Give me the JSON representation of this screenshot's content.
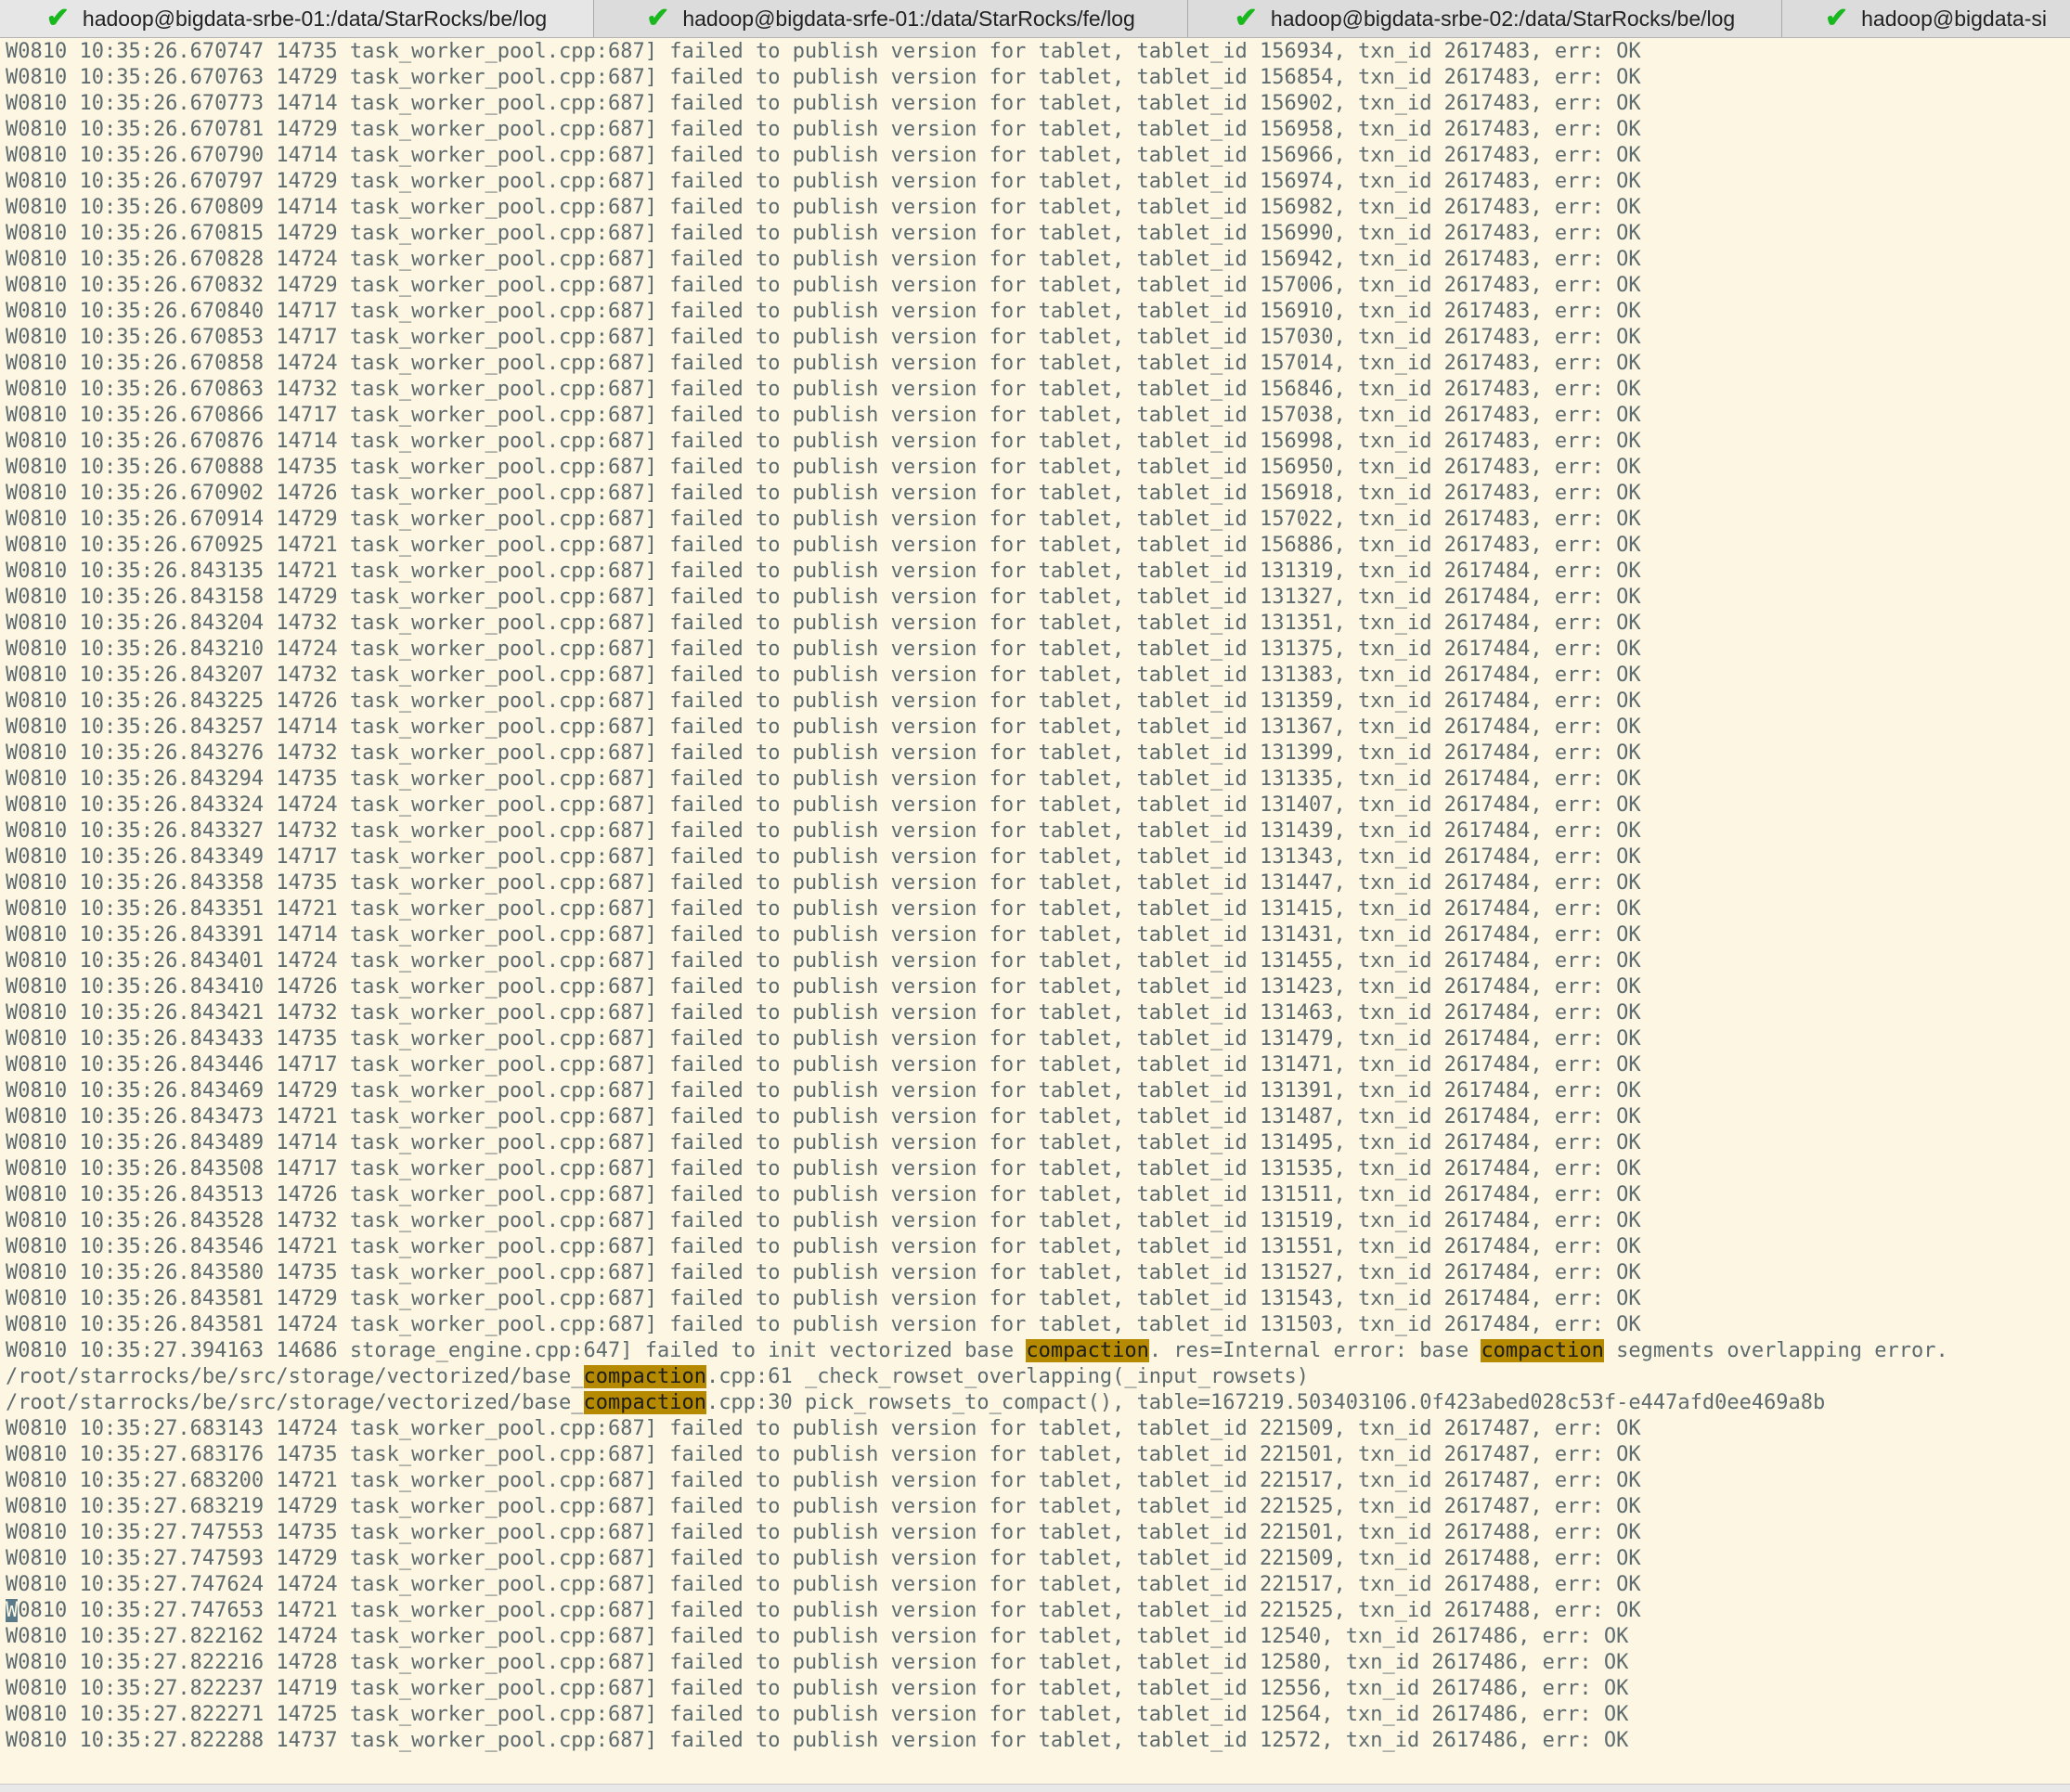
{
  "tabs": [
    {
      "title": "hadoop@bigdata-srbe-01:/data/StarRocks/be/log",
      "active": true
    },
    {
      "title": "hadoop@bigdata-srfe-01:/data/StarRocks/fe/log",
      "active": false
    },
    {
      "title": "hadoop@bigdata-srbe-02:/data/StarRocks/be/log",
      "active": false
    },
    {
      "title": "hadoop@bigdata-si",
      "active": false
    }
  ],
  "colors": {
    "background": "#fdf6e3",
    "text": "#5d6b6e",
    "highlight": "#b58a00",
    "tab_check": "#18b81e"
  },
  "highlight_term": "compaction",
  "terminal_lines": [
    "W0810 10:35:26.670747 14735 task_worker_pool.cpp:687] failed to publish version for tablet, tablet_id 156934, txn_id 2617483, err: OK",
    "W0810 10:35:26.670763 14729 task_worker_pool.cpp:687] failed to publish version for tablet, tablet_id 156854, txn_id 2617483, err: OK",
    "W0810 10:35:26.670773 14714 task_worker_pool.cpp:687] failed to publish version for tablet, tablet_id 156902, txn_id 2617483, err: OK",
    "W0810 10:35:26.670781 14729 task_worker_pool.cpp:687] failed to publish version for tablet, tablet_id 156958, txn_id 2617483, err: OK",
    "W0810 10:35:26.670790 14714 task_worker_pool.cpp:687] failed to publish version for tablet, tablet_id 156966, txn_id 2617483, err: OK",
    "W0810 10:35:26.670797 14729 task_worker_pool.cpp:687] failed to publish version for tablet, tablet_id 156974, txn_id 2617483, err: OK",
    "W0810 10:35:26.670809 14714 task_worker_pool.cpp:687] failed to publish version for tablet, tablet_id 156982, txn_id 2617483, err: OK",
    "W0810 10:35:26.670815 14729 task_worker_pool.cpp:687] failed to publish version for tablet, tablet_id 156990, txn_id 2617483, err: OK",
    "W0810 10:35:26.670828 14724 task_worker_pool.cpp:687] failed to publish version for tablet, tablet_id 156942, txn_id 2617483, err: OK",
    "W0810 10:35:26.670832 14729 task_worker_pool.cpp:687] failed to publish version for tablet, tablet_id 157006, txn_id 2617483, err: OK",
    "W0810 10:35:26.670840 14717 task_worker_pool.cpp:687] failed to publish version for tablet, tablet_id 156910, txn_id 2617483, err: OK",
    "W0810 10:35:26.670853 14717 task_worker_pool.cpp:687] failed to publish version for tablet, tablet_id 157030, txn_id 2617483, err: OK",
    "W0810 10:35:26.670858 14724 task_worker_pool.cpp:687] failed to publish version for tablet, tablet_id 157014, txn_id 2617483, err: OK",
    "W0810 10:35:26.670863 14732 task_worker_pool.cpp:687] failed to publish version for tablet, tablet_id 156846, txn_id 2617483, err: OK",
    "W0810 10:35:26.670866 14717 task_worker_pool.cpp:687] failed to publish version for tablet, tablet_id 157038, txn_id 2617483, err: OK",
    "W0810 10:35:26.670876 14714 task_worker_pool.cpp:687] failed to publish version for tablet, tablet_id 156998, txn_id 2617483, err: OK",
    "W0810 10:35:26.670888 14735 task_worker_pool.cpp:687] failed to publish version for tablet, tablet_id 156950, txn_id 2617483, err: OK",
    "W0810 10:35:26.670902 14726 task_worker_pool.cpp:687] failed to publish version for tablet, tablet_id 156918, txn_id 2617483, err: OK",
    "W0810 10:35:26.670914 14729 task_worker_pool.cpp:687] failed to publish version for tablet, tablet_id 157022, txn_id 2617483, err: OK",
    "W0810 10:35:26.670925 14721 task_worker_pool.cpp:687] failed to publish version for tablet, tablet_id 156886, txn_id 2617483, err: OK",
    "W0810 10:35:26.843135 14721 task_worker_pool.cpp:687] failed to publish version for tablet, tablet_id 131319, txn_id 2617484, err: OK",
    "W0810 10:35:26.843158 14729 task_worker_pool.cpp:687] failed to publish version for tablet, tablet_id 131327, txn_id 2617484, err: OK",
    "W0810 10:35:26.843204 14732 task_worker_pool.cpp:687] failed to publish version for tablet, tablet_id 131351, txn_id 2617484, err: OK",
    "W0810 10:35:26.843210 14724 task_worker_pool.cpp:687] failed to publish version for tablet, tablet_id 131375, txn_id 2617484, err: OK",
    "W0810 10:35:26.843207 14732 task_worker_pool.cpp:687] failed to publish version for tablet, tablet_id 131383, txn_id 2617484, err: OK",
    "W0810 10:35:26.843225 14726 task_worker_pool.cpp:687] failed to publish version for tablet, tablet_id 131359, txn_id 2617484, err: OK",
    "W0810 10:35:26.843257 14714 task_worker_pool.cpp:687] failed to publish version for tablet, tablet_id 131367, txn_id 2617484, err: OK",
    "W0810 10:35:26.843276 14732 task_worker_pool.cpp:687] failed to publish version for tablet, tablet_id 131399, txn_id 2617484, err: OK",
    "W0810 10:35:26.843294 14735 task_worker_pool.cpp:687] failed to publish version for tablet, tablet_id 131335, txn_id 2617484, err: OK",
    "W0810 10:35:26.843324 14724 task_worker_pool.cpp:687] failed to publish version for tablet, tablet_id 131407, txn_id 2617484, err: OK",
    "W0810 10:35:26.843327 14732 task_worker_pool.cpp:687] failed to publish version for tablet, tablet_id 131439, txn_id 2617484, err: OK",
    "W0810 10:35:26.843349 14717 task_worker_pool.cpp:687] failed to publish version for tablet, tablet_id 131343, txn_id 2617484, err: OK",
    "W0810 10:35:26.843358 14735 task_worker_pool.cpp:687] failed to publish version for tablet, tablet_id 131447, txn_id 2617484, err: OK",
    "W0810 10:35:26.843351 14721 task_worker_pool.cpp:687] failed to publish version for tablet, tablet_id 131415, txn_id 2617484, err: OK",
    "W0810 10:35:26.843391 14714 task_worker_pool.cpp:687] failed to publish version for tablet, tablet_id 131431, txn_id 2617484, err: OK",
    "W0810 10:35:26.843401 14724 task_worker_pool.cpp:687] failed to publish version for tablet, tablet_id 131455, txn_id 2617484, err: OK",
    "W0810 10:35:26.843410 14726 task_worker_pool.cpp:687] failed to publish version for tablet, tablet_id 131423, txn_id 2617484, err: OK",
    "W0810 10:35:26.843421 14732 task_worker_pool.cpp:687] failed to publish version for tablet, tablet_id 131463, txn_id 2617484, err: OK",
    "W0810 10:35:26.843433 14735 task_worker_pool.cpp:687] failed to publish version for tablet, tablet_id 131479, txn_id 2617484, err: OK",
    "W0810 10:35:26.843446 14717 task_worker_pool.cpp:687] failed to publish version for tablet, tablet_id 131471, txn_id 2617484, err: OK",
    "W0810 10:35:26.843469 14729 task_worker_pool.cpp:687] failed to publish version for tablet, tablet_id 131391, txn_id 2617484, err: OK",
    "W0810 10:35:26.843473 14721 task_worker_pool.cpp:687] failed to publish version for tablet, tablet_id 131487, txn_id 2617484, err: OK",
    "W0810 10:35:26.843489 14714 task_worker_pool.cpp:687] failed to publish version for tablet, tablet_id 131495, txn_id 2617484, err: OK",
    "W0810 10:35:26.843508 14717 task_worker_pool.cpp:687] failed to publish version for tablet, tablet_id 131535, txn_id 2617484, err: OK",
    "W0810 10:35:26.843513 14726 task_worker_pool.cpp:687] failed to publish version for tablet, tablet_id 131511, txn_id 2617484, err: OK",
    "W0810 10:35:26.843528 14732 task_worker_pool.cpp:687] failed to publish version for tablet, tablet_id 131519, txn_id 2617484, err: OK",
    "W0810 10:35:26.843546 14721 task_worker_pool.cpp:687] failed to publish version for tablet, tablet_id 131551, txn_id 2617484, err: OK",
    "W0810 10:35:26.843580 14735 task_worker_pool.cpp:687] failed to publish version for tablet, tablet_id 131527, txn_id 2617484, err: OK",
    "W0810 10:35:26.843581 14729 task_worker_pool.cpp:687] failed to publish version for tablet, tablet_id 131543, txn_id 2617484, err: OK",
    "W0810 10:35:26.843581 14724 task_worker_pool.cpp:687] failed to publish version for tablet, tablet_id 131503, txn_id 2617484, err: OK",
    "W0810 10:35:27.394163 14686 storage_engine.cpp:647] failed to init vectorized base compaction. res=Internal error: base compaction segments overlapping error.",
    "/root/starrocks/be/src/storage/vectorized/base_compaction.cpp:61 _check_rowset_overlapping(_input_rowsets)",
    "/root/starrocks/be/src/storage/vectorized/base_compaction.cpp:30 pick_rowsets_to_compact(), table=167219.503403106.0f423abed028c53f-e447afd0ee469a8b",
    "W0810 10:35:27.683143 14724 task_worker_pool.cpp:687] failed to publish version for tablet, tablet_id 221509, txn_id 2617487, err: OK",
    "W0810 10:35:27.683176 14735 task_worker_pool.cpp:687] failed to publish version for tablet, tablet_id 221501, txn_id 2617487, err: OK",
    "W0810 10:35:27.683200 14721 task_worker_pool.cpp:687] failed to publish version for tablet, tablet_id 221517, txn_id 2617487, err: OK",
    "W0810 10:35:27.683219 14729 task_worker_pool.cpp:687] failed to publish version for tablet, tablet_id 221525, txn_id 2617487, err: OK",
    "W0810 10:35:27.747553 14735 task_worker_pool.cpp:687] failed to publish version for tablet, tablet_id 221501, txn_id 2617488, err: OK",
    "W0810 10:35:27.747593 14729 task_worker_pool.cpp:687] failed to publish version for tablet, tablet_id 221509, txn_id 2617488, err: OK",
    "W0810 10:35:27.747624 14724 task_worker_pool.cpp:687] failed to publish version for tablet, tablet_id 221517, txn_id 2617488, err: OK",
    "W0810 10:35:27.747653 14721 task_worker_pool.cpp:687] failed to publish version for tablet, tablet_id 221525, txn_id 2617488, err: OK",
    "W0810 10:35:27.822162 14724 task_worker_pool.cpp:687] failed to publish version for tablet, tablet_id 12540, txn_id 2617486, err: OK",
    "W0810 10:35:27.822216 14728 task_worker_pool.cpp:687] failed to publish version for tablet, tablet_id 12580, txn_id 2617486, err: OK",
    "W0810 10:35:27.822237 14719 task_worker_pool.cpp:687] failed to publish version for tablet, tablet_id 12556, txn_id 2617486, err: OK",
    "W0810 10:35:27.822271 14725 task_worker_pool.cpp:687] failed to publish version for tablet, tablet_id 12564, txn_id 2617486, err: OK",
    "W0810 10:35:27.822288 14737 task_worker_pool.cpp:687] failed to publish version for tablet, tablet_id 12572, txn_id 2617486, err: OK"
  ],
  "cursor_line_index": 60
}
